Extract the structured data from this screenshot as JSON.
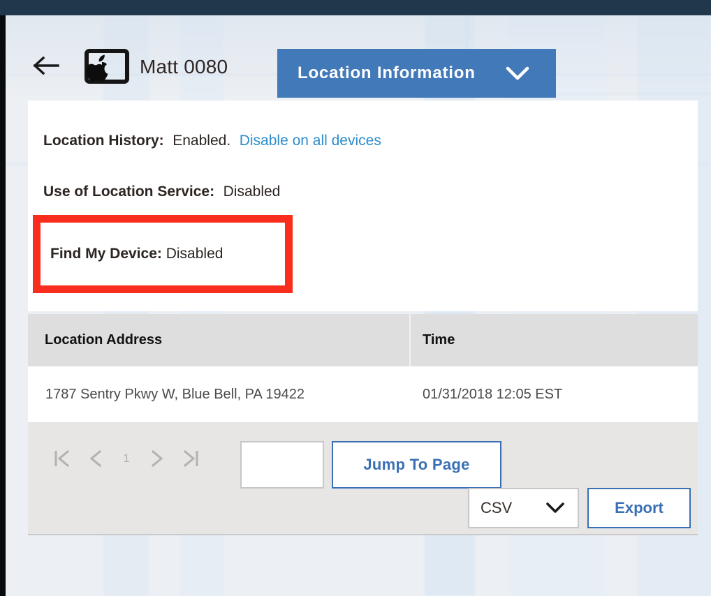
{
  "window": {
    "top_bar_color": "#21374b",
    "left_rail_color": "#080a0d",
    "page_background": "#eceff3"
  },
  "header": {
    "back_icon": "arrow-left-icon",
    "device_icon": "apple-device-icon",
    "device_name": "Matt 0080",
    "section_dropdown": {
      "label": "Location Information",
      "chevron_icon": "chevron-down-icon",
      "background": "#4279b9",
      "text_color": "#ffffff"
    }
  },
  "info_card": {
    "location_history": {
      "label": "Location History:",
      "value": "Enabled.",
      "link": "Disable on all devices",
      "link_color": "#2d8ccb"
    },
    "location_service": {
      "label": "Use of Location Service:",
      "value": "Disabled"
    },
    "find_my_device": {
      "label": "Find My Device:",
      "value": "Disabled",
      "highlight_color": "#f92d1e",
      "highlighted": true
    }
  },
  "table": {
    "columns": [
      "Location Address",
      "Time"
    ],
    "rows": [
      {
        "address": "1787 Sentry Pkwy W, Blue Bell, PA 19422",
        "time": "01/31/2018 12:05 EST"
      }
    ],
    "header_background": "#dedede"
  },
  "pagination": {
    "first_icon": "first-page-icon",
    "prev_icon": "chevron-left-icon",
    "current_page": "1",
    "next_icon": "chevron-right-icon",
    "last_icon": "last-page-icon",
    "jump_input_value": "",
    "jump_input_placeholder": "",
    "jump_button_label": "Jump To Page",
    "disabled_color": "#b2b2b2",
    "accent_color": "#3a6fb5"
  },
  "export": {
    "format_value": "CSV",
    "format_chevron_icon": "chevron-down-icon",
    "button_label": "Export",
    "accent_color": "#3a6fb5"
  }
}
